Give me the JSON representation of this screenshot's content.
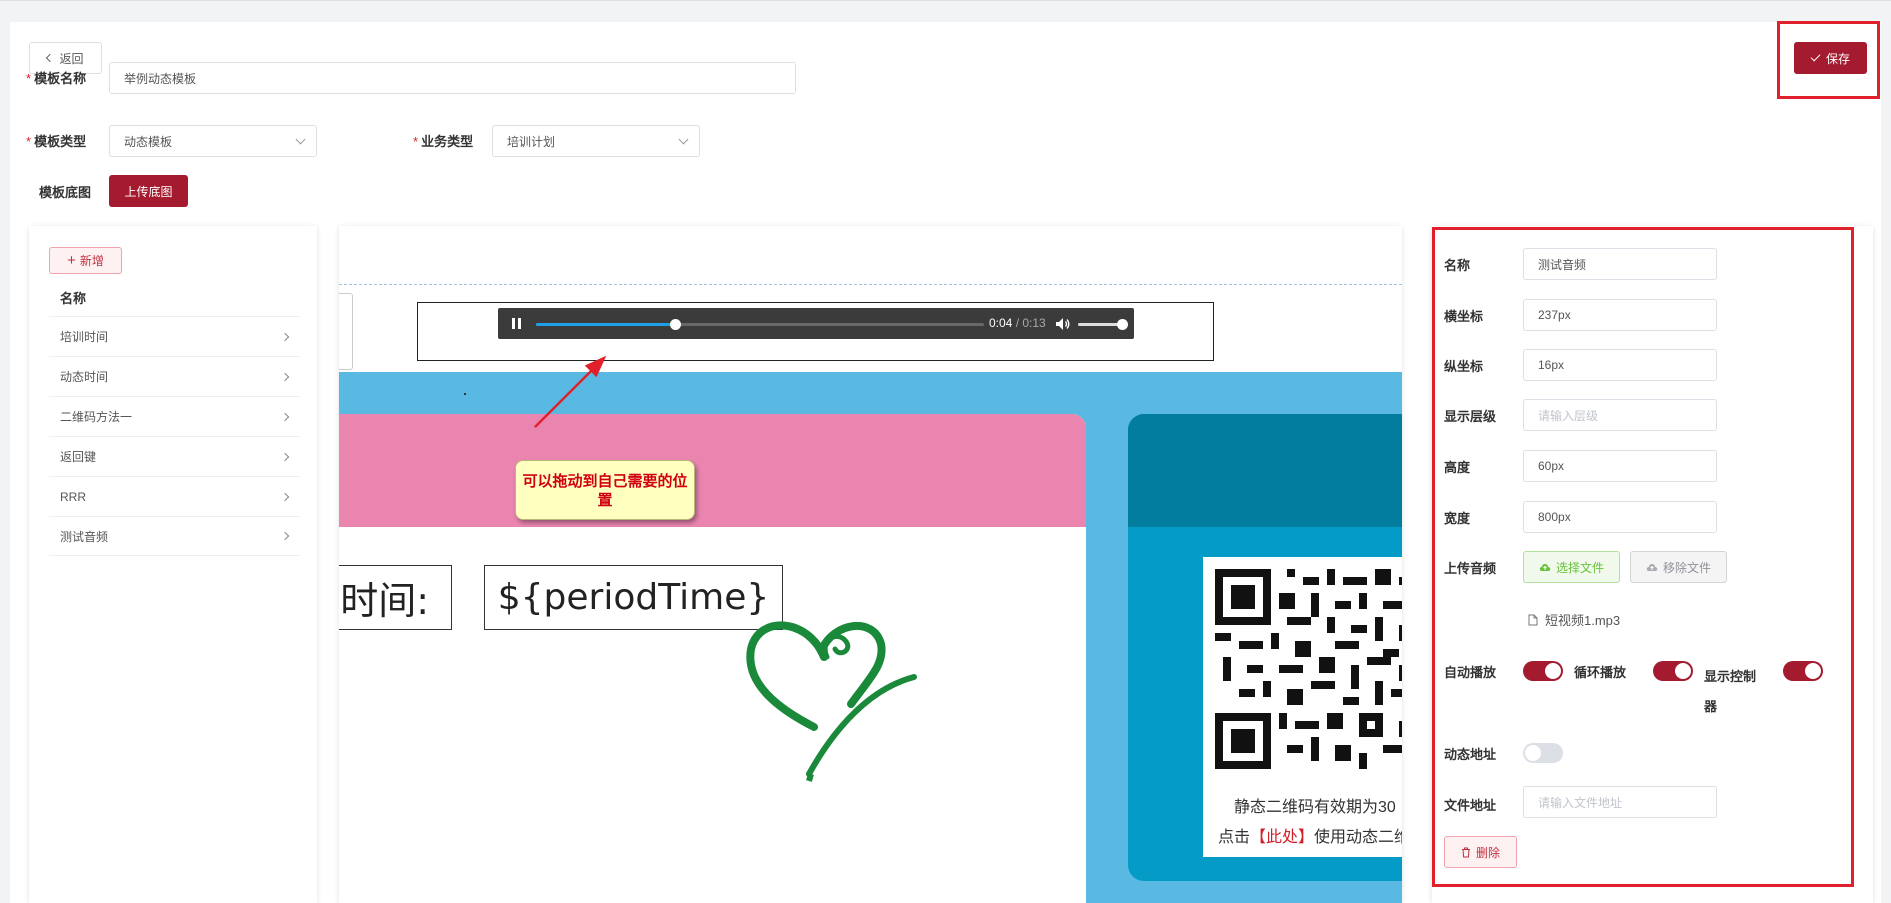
{
  "header": {
    "back_label": "返回",
    "save_label": "保存"
  },
  "form": {
    "template_name_label": "模板名称",
    "template_name_value": "举例动态模板",
    "template_type_label": "模板类型",
    "template_type_value": "动态模板",
    "business_type_label": "业务类型",
    "business_type_value": "培训计划",
    "template_bg_label": "模板底图",
    "upload_bg_label": "上传底图"
  },
  "left_panel": {
    "add_label": "新增",
    "column_header": "名称",
    "items": [
      {
        "label": "培训时间"
      },
      {
        "label": "动态时间"
      },
      {
        "label": "二维码方法一"
      },
      {
        "label": "返回键"
      },
      {
        "label": "RRR"
      },
      {
        "label": "测试音频"
      }
    ]
  },
  "canvas": {
    "box1_text": "时间:",
    "box2_text": "${periodTime}",
    "qr_caption_line1": "静态二维码有效期为30",
    "qr_caption_line2_pre": "点击",
    "qr_caption_line2_link": "【此处】",
    "qr_caption_line2_post": "使用动态二维",
    "audio": {
      "current_time": "0:04",
      "duration": "0:13",
      "progress": 0.31,
      "volume": 1.0,
      "state": "playing"
    },
    "callout_text": "可以拖动到自己需要的位置"
  },
  "right_panel": {
    "name_label": "名称",
    "name_value": "测试音频",
    "x_label": "横坐标",
    "x_value": "237px",
    "y_label": "纵坐标",
    "y_value": "16px",
    "z_label": "显示层级",
    "z_placeholder": "请输入层级",
    "height_label": "高度",
    "height_value": "60px",
    "width_label": "宽度",
    "width_value": "800px",
    "upload_audio_label": "上传音频",
    "choose_file_label": "选择文件",
    "remove_file_label": "移除文件",
    "file_name": "短视频1.mp3",
    "autoplay_label": "自动播放",
    "loop_label": "循环播放",
    "show_controls_label": "显示控制器",
    "autoplay_on": true,
    "loop_on": true,
    "show_controls_on": true,
    "dynamic_url_label": "动态地址",
    "dynamic_url_on": false,
    "file_url_label": "文件地址",
    "file_url_placeholder": "请输入文件地址",
    "delete_label": "删除"
  },
  "colors": {
    "primary": "#a41a2e",
    "highlight_box": "#e0202a",
    "pink_band": "#ea85b0",
    "blue_bg": "#5ab9e3",
    "teal_card": "#049cc6",
    "heart_green": "#1a8a3a"
  }
}
